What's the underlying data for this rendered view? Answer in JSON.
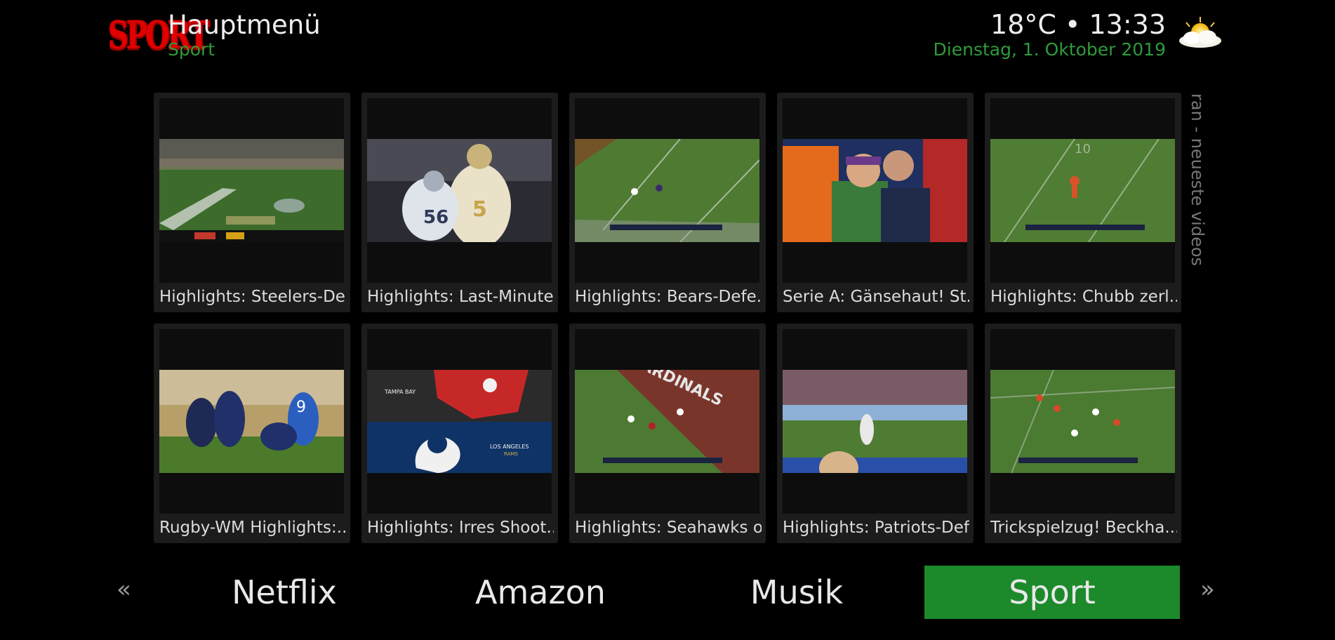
{
  "header": {
    "logo_text": "SPORT",
    "title": "Hauptmenü",
    "subtitle": "Sport",
    "clock": "18°C • 13:33",
    "date": "Dienstag, 1. Oktober 2019",
    "weather_icon": "partly-cloudy-icon"
  },
  "widget": {
    "side_label": "ran - neueste videos"
  },
  "tiles": [
    {
      "label": "Highlights: Steelers-De..."
    },
    {
      "label": "Highlights: Last-Minute..."
    },
    {
      "label": "Highlights: Bears-Defe..."
    },
    {
      "label": "Serie A: Gänsehaut! St..."
    },
    {
      "label": "Highlights: Chubb zerl..."
    },
    {
      "label": "Rugby-WM Highlights:..."
    },
    {
      "label": "Highlights: Irres Shoot..."
    },
    {
      "label": "Highlights: Seahawks o..."
    },
    {
      "label": "Highlights: Patriots-Def..."
    },
    {
      "label": "Trickspielzug! Beckha..."
    }
  ],
  "menu": {
    "prev_arrow": "«",
    "next_arrow": "»",
    "items": [
      {
        "label": "Netflix"
      },
      {
        "label": "Amazon"
      },
      {
        "label": "Musik"
      },
      {
        "label": "Sport"
      }
    ],
    "active_index": 3,
    "accent_color": "#1c8a2b"
  }
}
